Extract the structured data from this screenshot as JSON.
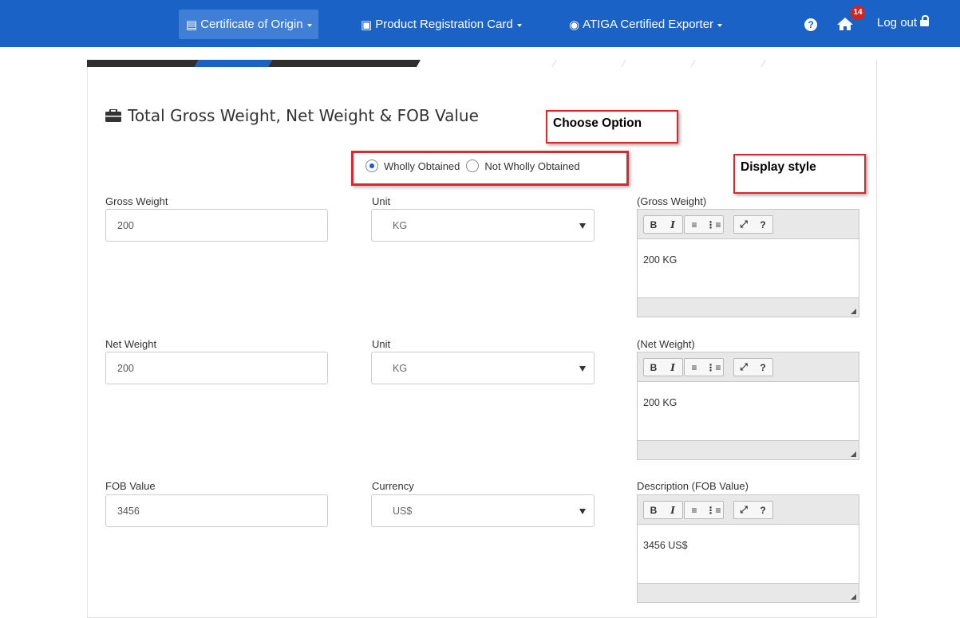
{
  "nav": {
    "certificate": "Certificate of Origin",
    "product": "Product Registration Card",
    "atiga": "ATIGA Certified Exporter",
    "badge": "14",
    "logout": "Log out"
  },
  "section": {
    "title": "Total Gross Weight, Net Weight & FOB Value"
  },
  "callouts": {
    "choose": "Choose Option",
    "display": "Display style"
  },
  "origin": {
    "wholly": "Wholly Obtained",
    "not_wholly": "Not Wholly Obtained",
    "selected": "Wholly Obtained"
  },
  "gross": {
    "label": "Gross Weight",
    "value": "200",
    "unit_label": "Unit",
    "unit": "KG",
    "editor_label": "(Gross Weight)",
    "editor_text": "200 KG"
  },
  "net": {
    "label": "Net Weight",
    "value": "200",
    "unit_label": "Unit",
    "unit": "KG",
    "editor_label": "(Net Weight)",
    "editor_text": "200 KG"
  },
  "fob": {
    "label": "FOB Value",
    "value": "3456",
    "currency_label": "Currency",
    "currency": "US$",
    "editor_label": "Description (FOB Value)",
    "editor_text": "3456 US$"
  },
  "toolbar": {
    "bold": "B",
    "italic": "I",
    "help": "?"
  },
  "colors": {
    "nav_bg": "#1a62c6",
    "accent": "#1a5ec2",
    "annotation": "#e0262a",
    "badge": "#d9221c"
  }
}
